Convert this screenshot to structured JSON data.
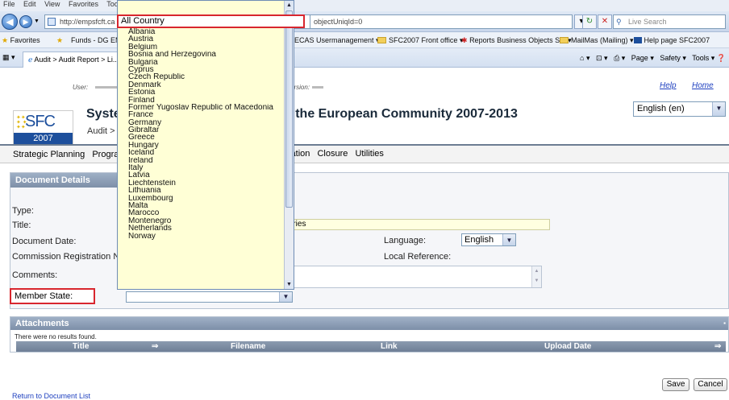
{
  "browser": {
    "menu": [
      "File",
      "Edit",
      "View",
      "Favorites",
      "Tools"
    ],
    "url": "http://empsfcft.ca",
    "url_tail": "objectUniqId=0",
    "search_placeholder": "Live Search",
    "favorites": [
      "Favorites",
      "Funds - DG EMP",
      "ECAS Usermanagement",
      "SFC2007 Front office",
      "Reports Business Objects S...",
      "MailMas (Mailing)",
      "Help page SFC2007"
    ],
    "tab_title": "Audit > Audit Report > Li...",
    "tools": [
      "Page",
      "Safety",
      "Tools"
    ]
  },
  "page": {
    "user_label": "User:",
    "version_label": "Version:",
    "help": "Help",
    "home": "Home",
    "logo_text": "SFC",
    "logo_year": "2007",
    "title_left": "Syster",
    "title_right": "n the European Community 2007-2013",
    "breadcrumb": "Audit > Au",
    "language_selected": "English (en)"
  },
  "nav": {
    "left": [
      "Strategic Planning",
      "Program"
    ],
    "right": [
      "luation",
      "Closure",
      "Utilities"
    ]
  },
  "document": {
    "header": "Document Details",
    "labels": {
      "type": "Type:",
      "title": "Title:",
      "date": "Document Date:",
      "commission": "Commission Registration Nº:",
      "comments": "Comments:",
      "member_state": "Member State:",
      "language": "Language:",
      "local_ref": "Local Reference:"
    },
    "title_value": "ntries",
    "language_value": "English"
  },
  "dropdown": {
    "selected": "All Country",
    "options": [
      "Albania",
      "Austria",
      "Belgium",
      "Bosnia and Herzegovina",
      "Bulgaria",
      "Cyprus",
      "Czech Republic",
      "Denmark",
      "Estonia",
      "Finland",
      "Former Yugoslav Republic of Macedonia",
      "France",
      "Germany",
      "Gibraltar",
      "Greece",
      "Hungary",
      "Iceland",
      "Ireland",
      "Italy",
      "Latvia",
      "Liechtenstein",
      "Lithuania",
      "Luxembourg",
      "Malta",
      "Marocco",
      "Montenegro",
      "Netherlands",
      "Norway"
    ]
  },
  "attachments": {
    "header": "Attachments",
    "empty": "There were no results found.",
    "columns": [
      "Title",
      "Filename",
      "Link",
      "Upload Date"
    ]
  },
  "actions": {
    "save": "Save",
    "cancel": "Cancel",
    "return": "Return to Document List"
  }
}
